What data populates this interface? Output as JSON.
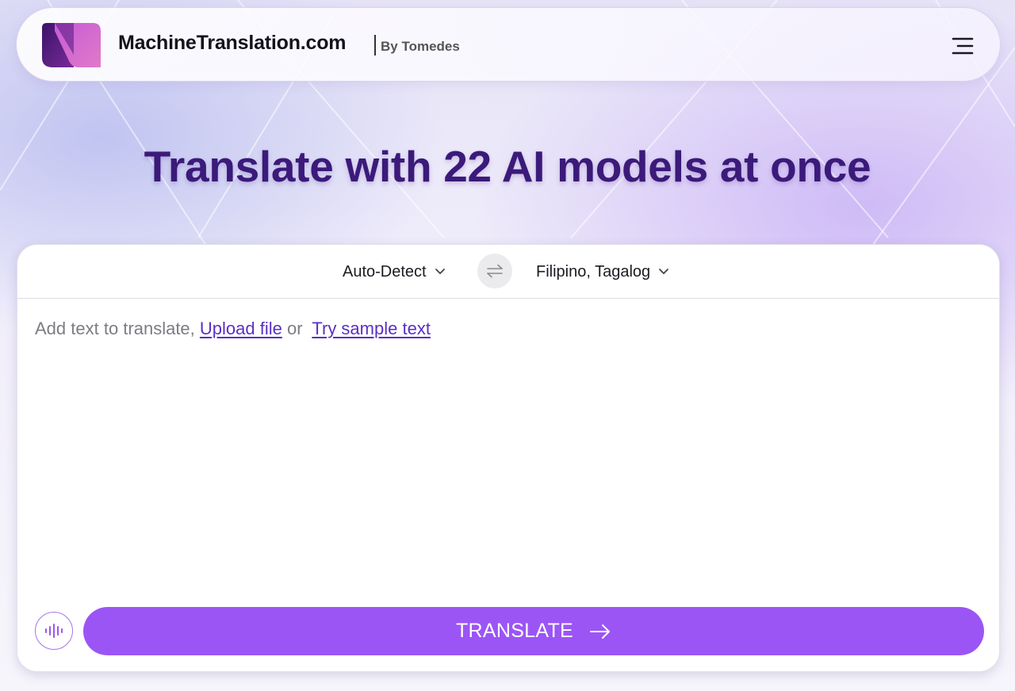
{
  "header": {
    "brand_name": "MachineTranslation.com",
    "byline": "By Tomedes",
    "menu_icon": "hamburger-menu-icon"
  },
  "hero": {
    "title": "Translate with 22 AI models at once"
  },
  "translator": {
    "source_language": "Auto-Detect",
    "target_language": "Filipino, Tagalog",
    "swap_icon": "swap-arrows-icon",
    "placeholder_prefix": "Add text to translate, ",
    "upload_link": "Upload file",
    "or_text": " or ",
    "sample_link": "Try sample text",
    "mic_icon": "voice-waveform-icon",
    "translate_label": "TRANSLATE",
    "translate_icon": "arrow-right-icon"
  },
  "colors": {
    "accent": "#9b55f5",
    "title": "#3b1a7a",
    "link": "#5a2fc4"
  }
}
